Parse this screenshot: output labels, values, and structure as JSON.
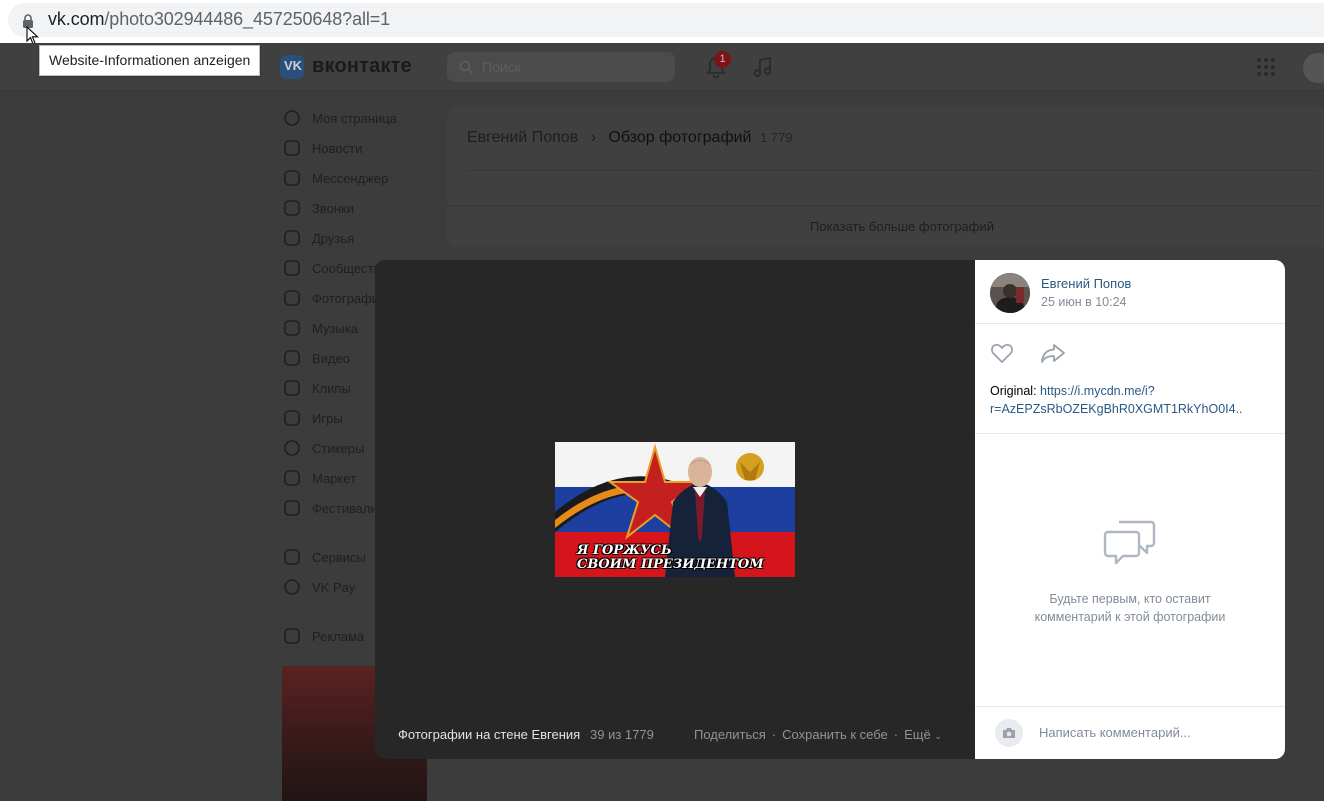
{
  "browser": {
    "url_domain": "vk.com",
    "url_path": "/photo302944486_457250648?all=1",
    "tooltip": "Website-Informationen anzeigen"
  },
  "header": {
    "logo_text": "вконтакте",
    "search_placeholder": "Поиск",
    "notifications_count": "1"
  },
  "nav": {
    "items": [
      {
        "label": "Моя страница",
        "icon": "user-circle-icon"
      },
      {
        "label": "Новости",
        "icon": "news-icon"
      },
      {
        "label": "Мессенджер",
        "icon": "chat-bubble-icon"
      },
      {
        "label": "Звонки",
        "icon": "phone-icon"
      },
      {
        "label": "Друзья",
        "icon": "friends-icon"
      },
      {
        "label": "Сообщества",
        "icon": "groups-icon"
      },
      {
        "label": "Фотографии",
        "icon": "photo-icon"
      },
      {
        "label": "Музыка",
        "icon": "music-icon"
      },
      {
        "label": "Видео",
        "icon": "video-icon"
      },
      {
        "label": "Клипы",
        "icon": "clips-icon"
      },
      {
        "label": "Игры",
        "icon": "gamepad-icon"
      },
      {
        "label": "Стикеры",
        "icon": "sticker-icon"
      },
      {
        "label": "Маркет",
        "icon": "bag-icon"
      },
      {
        "label": "Фестивали",
        "icon": "gift-icon"
      }
    ],
    "extra_items": [
      {
        "label": "Сервисы",
        "icon": "grid-icon"
      },
      {
        "label": "VK Pay",
        "icon": "ruble-icon"
      }
    ],
    "ads_label": "Реклама"
  },
  "breadcrumb": {
    "owner": "Евгений Попов",
    "section": "Обзор фотографий",
    "count": "1 779"
  },
  "show_more": "Показать больше фотографий",
  "viewer": {
    "photo_text_line1": "Я ГОРЖУСЬ",
    "photo_text_line2": "СВОИМ ПРЕЗИДЕНТОМ",
    "album_title": "Фотографии на стене Евгения",
    "position": "39 из 1779",
    "share": "Поделиться",
    "save": "Сохранить к себе",
    "more": "Ещё"
  },
  "panel": {
    "author": "Евгений Попов",
    "date": "25 июн в 10:24",
    "original_label": "Original:",
    "original_link_line1": "https://i.mycdn.me/i?",
    "original_link_line2": "r=AzEPZsRbOZEKgBhR0XGMT1RkYhO0I4..",
    "empty_line1": "Будьте первым, кто оставит",
    "empty_line2": "комментарий к этой фотографии",
    "comment_placeholder": "Написать комментарий..."
  },
  "colors": {
    "link": "#2a5885",
    "muted": "#818c99",
    "viewer_bg": "#272727",
    "overlay_bg": "#3c3c3c"
  }
}
